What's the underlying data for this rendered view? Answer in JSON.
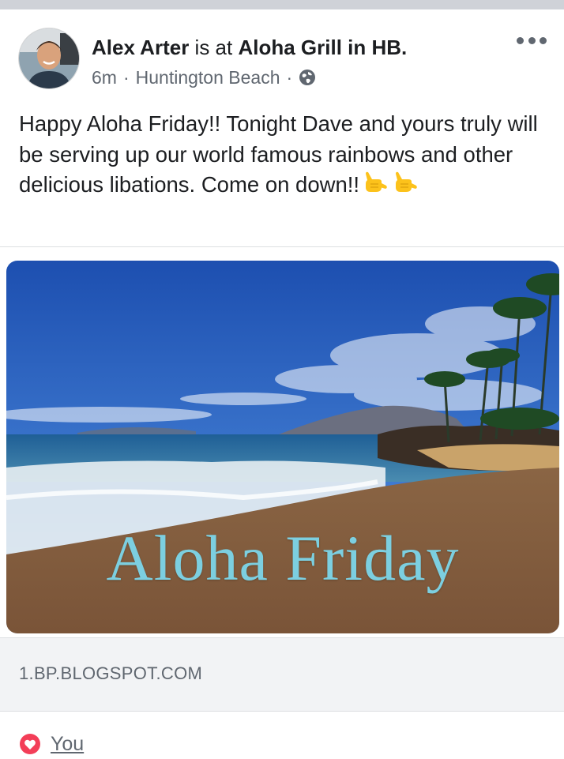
{
  "post": {
    "author": "Alex Arter",
    "connector": "is at",
    "place": "Aloha Grill in HB.",
    "time": "6m",
    "location": "Huntington Beach",
    "meta_separator": "·",
    "text": "Happy Aloha Friday!! Tonight Dave and yours truly will be serving up our world famous rainbows and other delicious libations. Come on down!!",
    "emoji": [
      "call-me-hand-icon",
      "call-me-hand-icon"
    ]
  },
  "link": {
    "image_text": "Aloha Friday",
    "domain": "1.BP.BLOGSPOT.COM"
  },
  "reactions": {
    "icon": "heart-icon",
    "names": "You"
  },
  "colors": {
    "heart": "#f33e58",
    "meta": "#606770",
    "overlay_text": "#7ccfe0"
  }
}
